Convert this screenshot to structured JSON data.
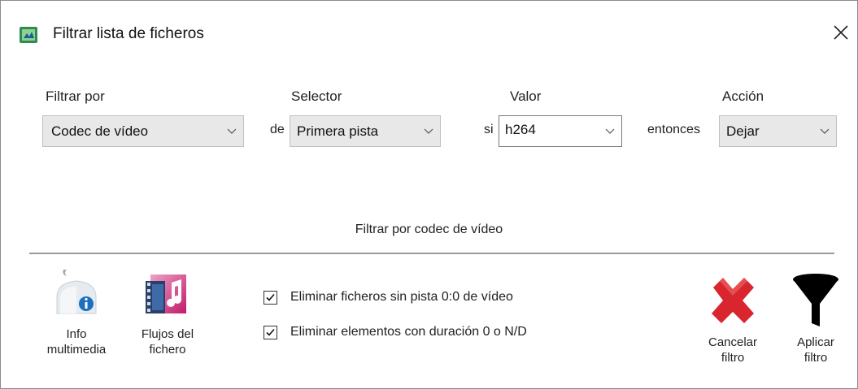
{
  "window": {
    "title": "Filtrar lista de ficheros"
  },
  "filter": {
    "columns": {
      "filter_by": "Filtrar por",
      "selector": "Selector",
      "value": "Valor",
      "action": "Acción"
    },
    "prefixes": {
      "de": "de",
      "si": "si",
      "entonces": "entonces"
    },
    "filter_by_value": "Codec de vídeo",
    "selector_value": "Primera pista",
    "value_value": "h264",
    "action_value": "Dejar",
    "hint": "Filtrar por codec de vídeo"
  },
  "options": [
    {
      "label": "Eliminar ficheros sin pista 0:0 de vídeo",
      "checked": true
    },
    {
      "label": "Eliminar elementos con duración 0 o N/D",
      "checked": true
    }
  ],
  "tools": {
    "info": {
      "line1": "Info",
      "line2": "multimedia",
      "icon": "info-media-icon"
    },
    "streams": {
      "line1": "Flujos del",
      "line2": "fichero",
      "icon": "streams-icon"
    },
    "cancel": {
      "line1": "Cancelar",
      "line2": "filtro",
      "icon": "red-x-icon"
    },
    "apply": {
      "line1": "Aplicar",
      "line2": "filtro",
      "icon": "funnel-icon"
    }
  },
  "colors": {
    "cancel_red": "#d9262e",
    "funnel_black": "#000000",
    "info_blue": "#1f6fc1"
  }
}
